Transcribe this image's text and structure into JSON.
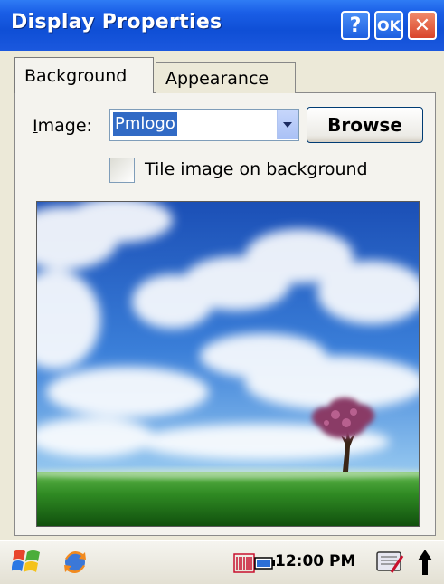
{
  "window": {
    "title": "Display Properties",
    "help_label": "?",
    "ok_label": "OK",
    "close_label": "✕"
  },
  "tabs": [
    {
      "label": "Background",
      "active": true
    },
    {
      "label": "Appearance",
      "active": false
    }
  ],
  "background": {
    "image_label_underlined": "I",
    "image_label_rest": "mage:",
    "image_value": "Pmlogo",
    "browse_label": "Browse",
    "tile_label": "Tile image on background",
    "tile_checked": false
  },
  "taskbar": {
    "time": "12:00 PM",
    "icons": [
      "start-flag-icon",
      "sync-icon",
      "scanner-icon",
      "battery-icon",
      "keyboard-input-icon",
      "up-arrow-icon"
    ]
  },
  "colors": {
    "titlebar": "#1a5ee6",
    "close_button": "#d9442a",
    "selection": "#316ac5",
    "dialog_bg": "#ece9d8"
  }
}
